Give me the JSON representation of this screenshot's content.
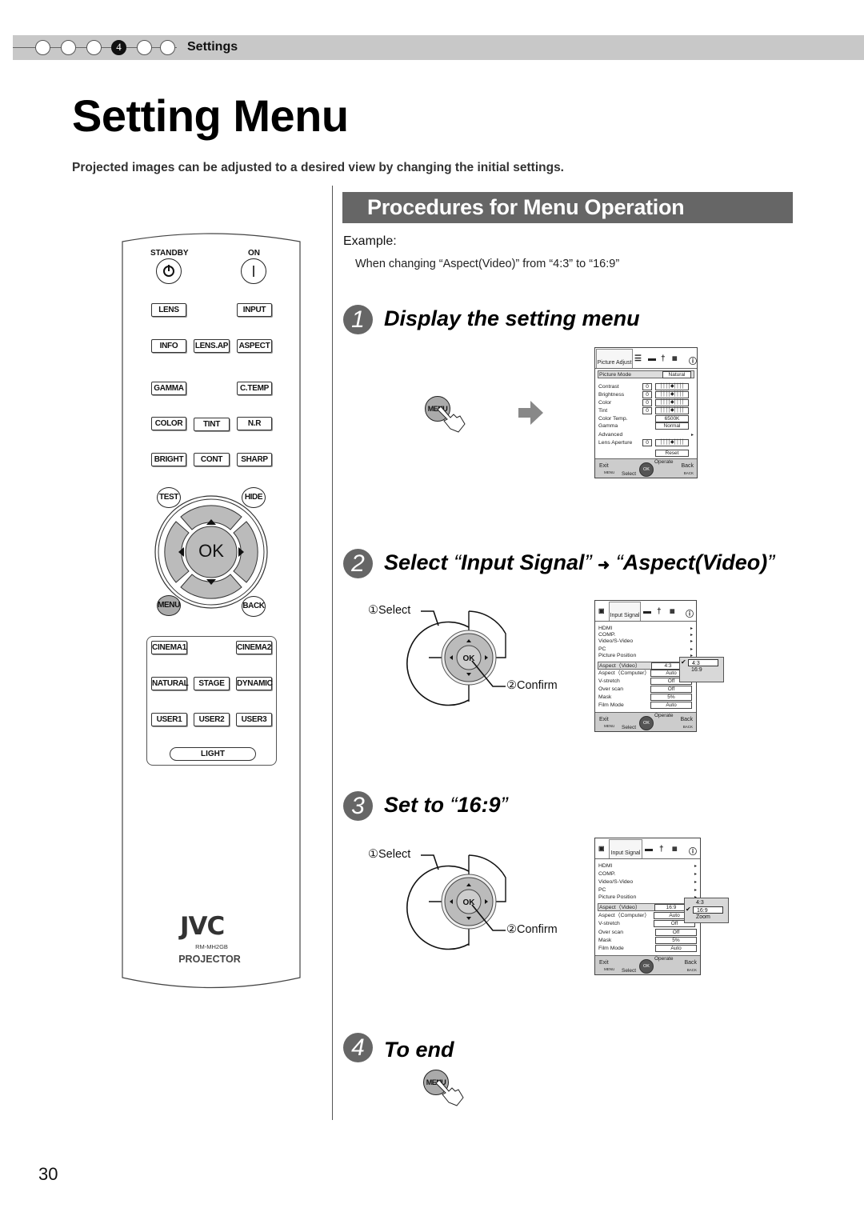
{
  "header": {
    "step_dots": [
      "",
      "",
      "",
      "4",
      "",
      ""
    ],
    "active_step": 4,
    "section": "Settings"
  },
  "page_title": "Setting Menu",
  "intro": "Projected images can be adjusted to a desired view by changing the initial settings.",
  "remote": {
    "power": {
      "standby": "STANDBY",
      "on": "ON"
    },
    "rows": [
      [
        "LENS",
        "",
        "INPUT"
      ],
      [
        "INFO",
        "LENS.AP",
        "ASPECT"
      ],
      [
        "GAMMA",
        "",
        "C.TEMP"
      ],
      [
        "COLOR",
        "TINT",
        "N.R"
      ],
      [
        "BRIGHT",
        "CONT",
        "SHARP"
      ]
    ],
    "nav": {
      "test": "TEST",
      "hide": "HIDE",
      "ok": "OK",
      "menu": "MENU",
      "back": "BACK"
    },
    "presets": [
      [
        "CINEMA1",
        "",
        "CINEMA2"
      ],
      [
        "NATURAL",
        "STAGE",
        "DYNAMIC"
      ],
      [
        "USER1",
        "USER2",
        "USER3"
      ]
    ],
    "light": "LIGHT",
    "brand": "JVC",
    "model": "RM-MH2GB",
    "product": "PROJECTOR"
  },
  "section_heading": "Procedures for Menu Operation",
  "example": {
    "label": "Example:",
    "text": "When changing “Aspect(Video)” from “4:3” to “16:9”"
  },
  "steps": [
    {
      "num": "1",
      "title": "Display the setting menu"
    },
    {
      "num": "2",
      "title_a": "Select",
      "q1": "“",
      "title_b": "Input Signal",
      "q2": "”",
      "arrow": "➜",
      "q3": "“",
      "title_c": "Aspect(Video)",
      "q4": "”"
    },
    {
      "num": "3",
      "title_a": "Set to",
      "q1": "“",
      "title_b": "16:9",
      "q2": "”"
    },
    {
      "num": "4",
      "title": "To end"
    }
  ],
  "press_label": "MENU",
  "dpad": {
    "select": "①Select",
    "confirm": "②Confirm",
    "ok": "OK"
  },
  "osd_picture": {
    "tab": "Picture Adjust",
    "mode_label": "Picture Mode",
    "mode_value": "Natural",
    "rows": [
      {
        "label": "Contrast",
        "num": "0"
      },
      {
        "label": "Brightness",
        "num": "0"
      },
      {
        "label": "Color",
        "num": "0"
      },
      {
        "label": "Tint",
        "num": "0"
      }
    ],
    "color_temp": {
      "label": "Color Temp.",
      "value": "6500K"
    },
    "gamma": {
      "label": "Gamma",
      "value": "Normal"
    },
    "advanced": "Advanced",
    "lens_aperture": {
      "label": "Lens Aperture",
      "num": "0"
    },
    "reset": "Reset"
  },
  "osd_input": {
    "tab": "Input Signal",
    "submenus": [
      "HDMI",
      "COMP.",
      "Video/S-Video",
      "PC",
      "Picture Position"
    ],
    "settings": [
      {
        "label": "Aspect（Video）",
        "value": "4:3"
      },
      {
        "label": "Aspect（Computer）",
        "value": "Auto"
      },
      {
        "label": "V-stretch",
        "value": "Off"
      },
      {
        "label": "Over scan",
        "value": "Off"
      },
      {
        "label": "Mask",
        "value": "5%"
      },
      {
        "label": "Film Mode",
        "value": "Auto"
      }
    ],
    "popup_step2": [
      "4:3",
      "16:9"
    ],
    "popup_step2_selected": "4:3",
    "aspect_after": "16:9",
    "popup_step3": [
      "4:3",
      "16:9",
      "Zoom"
    ],
    "popup_step3_selected": "16:9"
  },
  "osd_footer": {
    "exit": "Exit",
    "menu_key": "MENU",
    "select": "Select",
    "operate": "Operate",
    "back": "Back",
    "back_key": "BACK",
    "dial": "OK"
  },
  "page_number": "30"
}
